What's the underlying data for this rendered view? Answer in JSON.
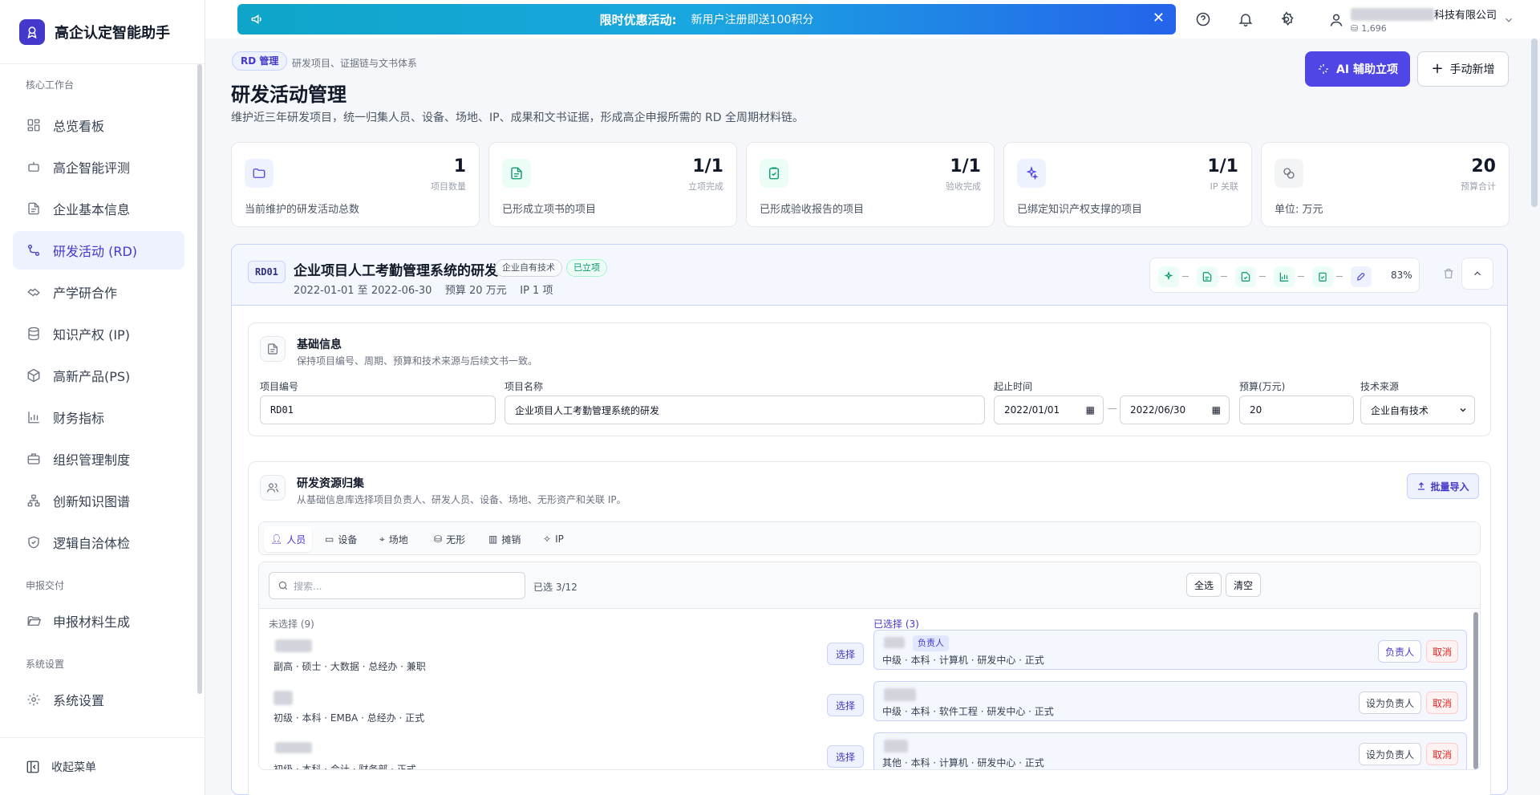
{
  "sidebar": {
    "brand": "高企认定智能助手",
    "sections": [
      {
        "label": "核心工作台"
      },
      {
        "label": "申报交付"
      },
      {
        "label": "系统设置"
      }
    ],
    "items": [
      {
        "label": "总览看板",
        "icon": "dashboard-icon"
      },
      {
        "label": "高企智能评测",
        "icon": "robot-icon"
      },
      {
        "label": "企业基本信息",
        "icon": "document-icon"
      },
      {
        "label": "研发活动 (RD)",
        "icon": "workflow-icon",
        "active": true
      },
      {
        "label": "产学研合作",
        "icon": "handshake-icon"
      },
      {
        "label": "知识产权 (IP)",
        "icon": "database-icon"
      },
      {
        "label": "高新产品(PS)",
        "icon": "package-icon"
      },
      {
        "label": "财务指标",
        "icon": "bar-chart-icon"
      },
      {
        "label": "组织管理制度",
        "icon": "briefcase-icon"
      },
      {
        "label": "创新知识图谱",
        "icon": "network-icon"
      },
      {
        "label": "逻辑自洽体检",
        "icon": "shield-check-icon"
      },
      {
        "label": "申报材料生成",
        "icon": "folder-open-icon"
      },
      {
        "label": "系统设置",
        "icon": "gear-icon"
      }
    ],
    "collapse_label": "收起菜单"
  },
  "topbar": {
    "promo_title": "限时优惠活动:",
    "promo_text": "新用户注册即送100积分",
    "company_suffix": "科技有限公司",
    "points": "1,696"
  },
  "header": {
    "tag": "RD 管理",
    "tag_sub": "研发项目、证据链与文书体系",
    "title": "研发活动管理",
    "description": "维护近三年研发项目，统一归集人员、设备、场地、IP、成果和文书证据，形成高企申报所需的 RD 全周期材料链。",
    "ai_button": "AI 辅助立项",
    "new_button": "手动新增"
  },
  "stats": [
    {
      "value": "1",
      "label": "项目数量",
      "desc": "当前维护的研发活动总数",
      "icon": "folder-icon",
      "color": "#4f46e5"
    },
    {
      "value": "1/1",
      "label": "立项完成",
      "desc": "已形成立项书的项目",
      "icon": "file-text-icon",
      "color": "#059669"
    },
    {
      "value": "1/1",
      "label": "验收完成",
      "desc": "已形成验收报告的项目",
      "icon": "clipboard-check-icon",
      "color": "#059669"
    },
    {
      "value": "1/1",
      "label": "IP 关联",
      "desc": "已绑定知识产权支撑的项目",
      "icon": "sparkle-icon",
      "color": "#4f46e5"
    },
    {
      "value": "20",
      "label": "预算合计",
      "desc": "单位: 万元",
      "icon": "coins-icon",
      "color": "#6b7280"
    }
  ],
  "project": {
    "code": "RD01",
    "title": "企业项目人工考勤管理系统的研发",
    "source_chip": "企业自有技术",
    "status_chip": "已立项",
    "period": "2022-01-01 至 2022-06-30",
    "budget": "预算 20 万元",
    "ip_count": "IP 1 项",
    "progress": "83%",
    "progress_value": 0.83,
    "basic": {
      "title": "基础信息",
      "desc": "保持项目编号、周期、预算和技术来源与后续文书一致。",
      "fields": {
        "code_label": "项目编号",
        "code_value": "RD01",
        "name_label": "项目名称",
        "name_value": "企业项目人工考勤管理系统的研发",
        "start_label": "起止时间",
        "start_value": "2022/01/01",
        "sep": "—",
        "end_value": "2022/06/30",
        "budget_label": "预算(万元)",
        "budget_value": "20",
        "source_label": "技术来源",
        "source_value": "企业自有技术"
      }
    },
    "resources": {
      "title": "研发资源归集",
      "desc": "从基础信息库选择项目负责人、研发人员、设备、场地、无形资产和关联 IP。",
      "batch_button": "批量导入",
      "tabs": [
        "人员",
        "设备",
        "场地",
        "无形",
        "摊销",
        "IP"
      ],
      "search_placeholder": "搜索...",
      "selected_count": "已选 3/12",
      "select_all": "全选",
      "clear": "清空",
      "unselected_header": "未选择 (9)",
      "selected_header": "已选择 (3)",
      "unselected": [
        {
          "meta": "副高 · 硕士 · 大数据 · 总经办 · 兼职",
          "action": "选择"
        },
        {
          "meta": "初级 · 本科 · EMBA · 总经办 · 正式",
          "action": "选择"
        },
        {
          "meta": "初级 · 本科 · 会计 · 财务部 · 正式",
          "action": "选择"
        }
      ],
      "selected": [
        {
          "meta": "中级 · 本科 · 计算机 · 研发中心 · 正式",
          "badge": "负责人",
          "role_btn": "负责人",
          "cancel": "取消"
        },
        {
          "meta": "中级 · 本科 · 软件工程 · 研发中心 · 正式",
          "role_btn": "设为负责人",
          "cancel": "取消"
        },
        {
          "meta": "其他 · 本科 · 计算机 · 研发中心 · 正式",
          "role_btn": "设为负责人",
          "cancel": "取消"
        }
      ]
    }
  }
}
